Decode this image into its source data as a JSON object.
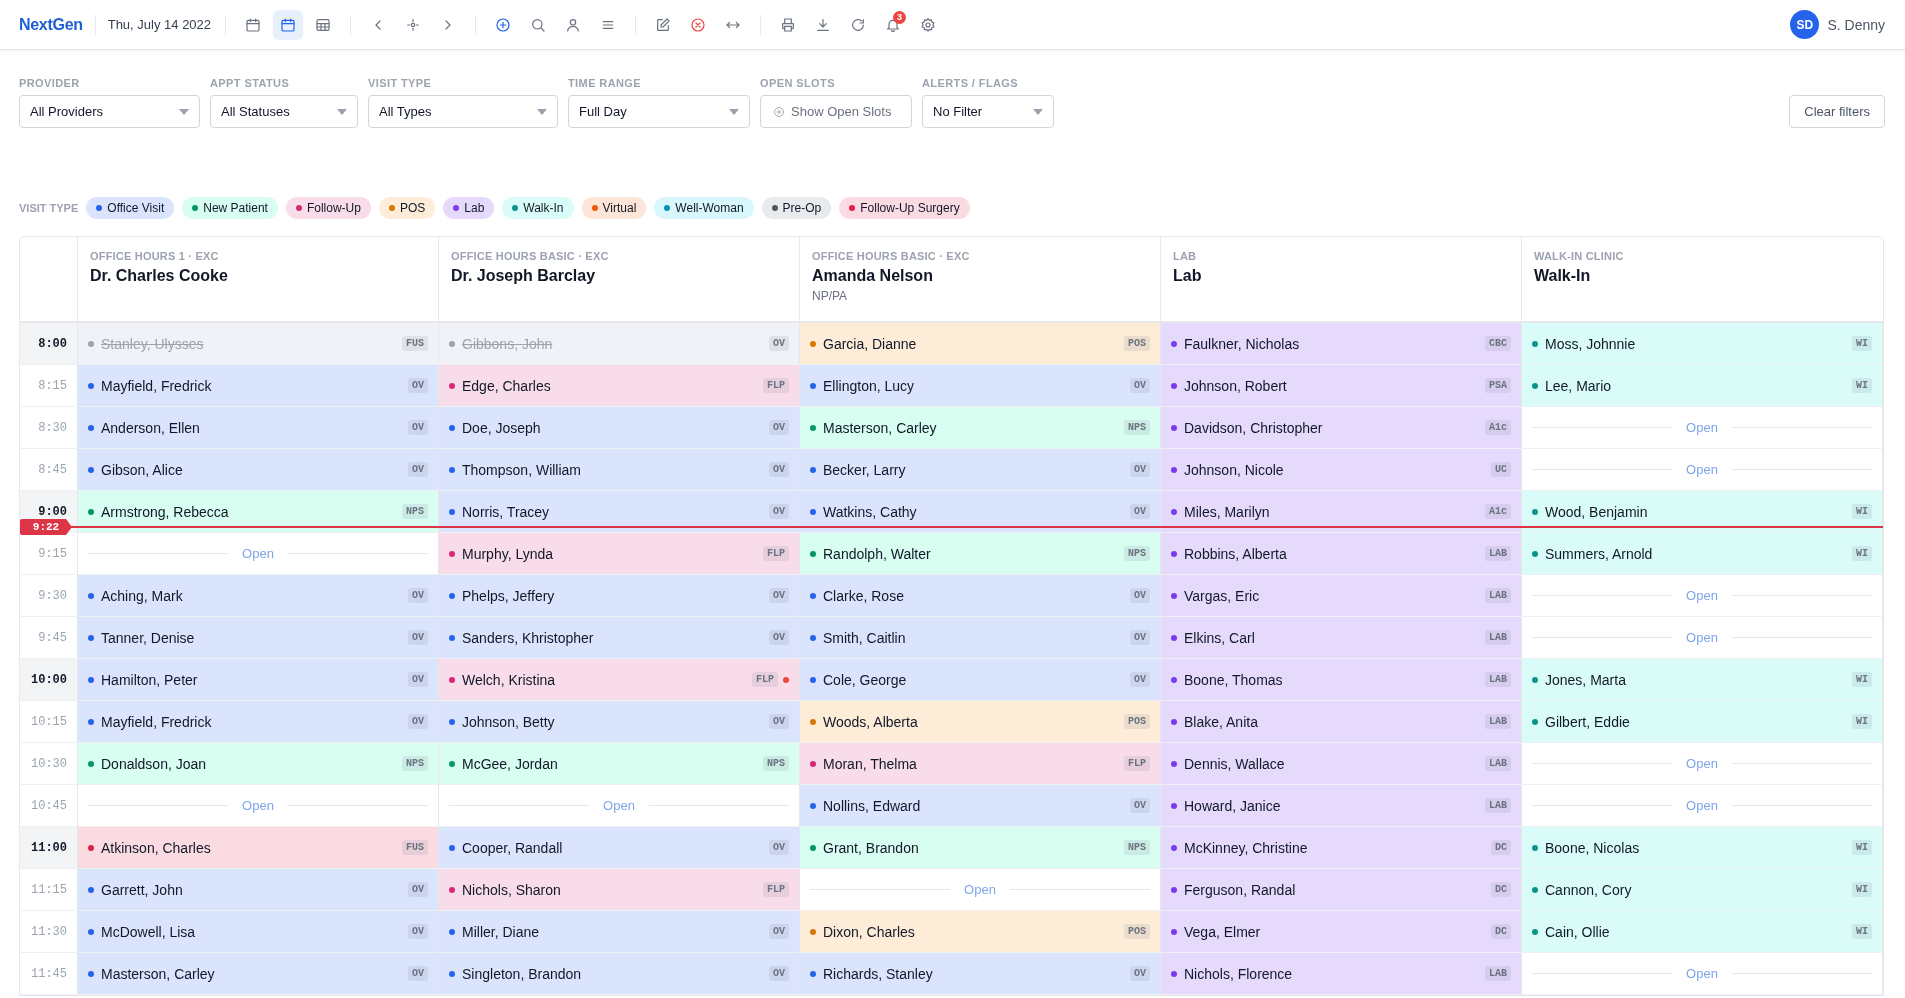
{
  "app": {
    "logo": "NextGen",
    "date": "Thu, July 14 2022"
  },
  "toolbar": [
    [
      {
        "kind": "calendar-day",
        "selected": false
      },
      {
        "kind": "calendar-week",
        "selected": true
      },
      {
        "kind": "table-grid",
        "selected": false
      }
    ],
    [
      {
        "kind": "chevron-left",
        "selected": false
      },
      {
        "kind": "crosshair",
        "selected": false
      },
      {
        "kind": "chevron-right",
        "selected": false
      }
    ],
    [
      {
        "kind": "plus-circle",
        "selected": false
      },
      {
        "kind": "search",
        "selected": false
      },
      {
        "kind": "user",
        "selected": false
      },
      {
        "kind": "list",
        "selected": false
      }
    ],
    [
      {
        "kind": "edit",
        "selected": false
      },
      {
        "kind": "x-circle",
        "selected": false
      },
      {
        "kind": "arrows-horizontal",
        "selected": false
      }
    ],
    [
      {
        "kind": "printer",
        "selected": false
      },
      {
        "kind": "download",
        "selected": false
      },
      {
        "kind": "refresh",
        "selected": false
      },
      {
        "kind": "bell",
        "selected": false,
        "badge": "3"
      },
      {
        "kind": "settings",
        "selected": false
      }
    ]
  ],
  "user": {
    "initials": "SD",
    "name": "S. Denny"
  },
  "filters": [
    {
      "label": "PROVIDER",
      "value": "All Providers",
      "kind": "select"
    },
    {
      "label": "APPT STATUS",
      "value": "All Statuses",
      "kind": "select"
    },
    {
      "label": "VISIT TYPE",
      "value": "All Types",
      "kind": "select"
    },
    {
      "label": "TIME RANGE",
      "value": "Full Day",
      "kind": "select"
    },
    {
      "label": "OPEN SLOTS",
      "value": "Show Open Slots",
      "kind": "toggle"
    },
    {
      "label": "ALERTS / FLAGS",
      "value": "No Filter",
      "kind": "select"
    }
  ],
  "clear_filters": "Clear filters",
  "legend": {
    "label": "VISIT TYPE",
    "items": [
      {
        "label": "Office Visit",
        "color": "#2563eb"
      },
      {
        "label": "New Patient",
        "color": "#059669"
      },
      {
        "label": "Follow-Up",
        "color": "#db2777"
      },
      {
        "label": "POS",
        "color": "#d97706"
      },
      {
        "label": "Lab",
        "color": "#7c3aed"
      },
      {
        "label": "Walk-In",
        "color": "#0d9488"
      },
      {
        "label": "Virtual",
        "color": "#ea580c"
      },
      {
        "label": "Well-Woman",
        "color": "#0891b2"
      },
      {
        "label": "Pre-Op",
        "color": "#4b5563"
      },
      {
        "label": "Follow-Up Surgery",
        "color": "#e11d48"
      }
    ]
  },
  "schedule": {
    "columns": [
      {
        "group": "OFFICE HOURS 1 · EXC",
        "name": "Dr. Charles Cooke"
      },
      {
        "group": "OFFICE HOURS BASIC · EXC",
        "name": "Dr. Joseph Barclay"
      },
      {
        "group": "OFFICE HOURS BASIC · EXC",
        "name": "Amanda Nelson",
        "credentials": "NP/PA"
      },
      {
        "group": "LAB",
        "name": "Lab"
      },
      {
        "group": "WALK-IN CLINIC",
        "name": "Walk-In"
      }
    ],
    "now_marker": "9:22",
    "rows": [
      {
        "time": "8:00",
        "hour": true,
        "slots": [
          {
            "kind": "cancelled",
            "patient": "Stanley, Ulysses",
            "code": "FUS"
          },
          {
            "kind": "cancelled",
            "patient": "Gibbons, John",
            "code": "OV"
          },
          {
            "kind": "booked",
            "patient": "Garcia, Dianne",
            "code": "POS",
            "color": "#d97706",
            "flag": false
          },
          {
            "kind": "booked",
            "patient": "Faulkner, Nicholas",
            "code": "CBC",
            "color": "#7c3aed",
            "flag": false
          },
          {
            "kind": "booked",
            "patient": "Moss, Johnnie",
            "code": "WI",
            "color": "#0d9488",
            "flag": false
          }
        ]
      },
      {
        "time": "8:15",
        "hour": false,
        "slots": [
          {
            "kind": "booked",
            "patient": "Mayfield, Fredrick",
            "code": "OV",
            "color": "#2563eb",
            "flag": false
          },
          {
            "kind": "booked",
            "patient": "Edge, Charles",
            "code": "FLP",
            "color": "#db2777",
            "flag": false
          },
          {
            "kind": "booked",
            "patient": "Ellington, Lucy",
            "code": "OV",
            "color": "#2563eb",
            "flag": false
          },
          {
            "kind": "booked",
            "patient": "Johnson, Robert",
            "code": "PSA",
            "color": "#7c3aed",
            "flag": false
          },
          {
            "kind": "booked",
            "patient": "Lee, Mario",
            "code": "WI",
            "color": "#0d9488",
            "flag": false
          }
        ]
      },
      {
        "time": "8:30",
        "hour": false,
        "slots": [
          {
            "kind": "booked",
            "patient": "Anderson, Ellen",
            "code": "OV",
            "color": "#2563eb",
            "flag": false
          },
          {
            "kind": "booked",
            "patient": "Doe, Joseph",
            "code": "OV",
            "color": "#2563eb",
            "flag": false
          },
          {
            "kind": "booked",
            "patient": "Masterson, Carley",
            "code": "NPS",
            "color": "#059669",
            "flag": false
          },
          {
            "kind": "booked",
            "patient": "Davidson, Christopher",
            "code": "A1c",
            "color": "#7c3aed",
            "flag": false
          },
          {
            "kind": "open",
            "label": "Open"
          }
        ]
      },
      {
        "time": "8:45",
        "hour": false,
        "slots": [
          {
            "kind": "booked",
            "patient": "Gibson, Alice",
            "code": "OV",
            "color": "#2563eb",
            "flag": false
          },
          {
            "kind": "booked",
            "patient": "Thompson, William",
            "code": "OV",
            "color": "#2563eb",
            "flag": false
          },
          {
            "kind": "booked",
            "patient": "Becker, Larry",
            "code": "OV",
            "color": "#2563eb",
            "flag": false
          },
          {
            "kind": "booked",
            "patient": "Johnson, Nicole",
            "code": "UC",
            "color": "#7c3aed",
            "flag": false
          },
          {
            "kind": "open",
            "label": "Open"
          }
        ]
      },
      {
        "time": "9:00",
        "hour": true,
        "slots": [
          {
            "kind": "booked",
            "patient": "Armstrong, Rebecca",
            "code": "NPS",
            "color": "#059669",
            "flag": false
          },
          {
            "kind": "booked",
            "patient": "Norris, Tracey",
            "code": "OV",
            "color": "#2563eb",
            "flag": false
          },
          {
            "kind": "booked",
            "patient": "Watkins, Cathy",
            "code": "OV",
            "color": "#2563eb",
            "flag": false
          },
          {
            "kind": "booked",
            "patient": "Miles, Marilyn",
            "code": "A1c",
            "color": "#7c3aed",
            "flag": false
          },
          {
            "kind": "booked",
            "patient": "Wood, Benjamin",
            "code": "WI",
            "color": "#0d9488",
            "flag": false
          }
        ]
      },
      {
        "time": "9:15",
        "hour": false,
        "slots": [
          {
            "kind": "open",
            "label": "Open"
          },
          {
            "kind": "booked",
            "patient": "Murphy, Lynda",
            "code": "FLP",
            "color": "#db2777",
            "flag": false
          },
          {
            "kind": "booked",
            "patient": "Randolph, Walter",
            "code": "NPS",
            "color": "#059669",
            "flag": false
          },
          {
            "kind": "booked",
            "patient": "Robbins, Alberta",
            "code": "LAB",
            "color": "#7c3aed",
            "flag": false
          },
          {
            "kind": "booked",
            "patient": "Summers, Arnold",
            "code": "WI",
            "color": "#0d9488",
            "flag": false
          }
        ]
      },
      {
        "time": "9:30",
        "hour": false,
        "slots": [
          {
            "kind": "booked",
            "patient": "Aching, Mark",
            "code": "OV",
            "color": "#2563eb",
            "flag": false
          },
          {
            "kind": "booked",
            "patient": "Phelps, Jeffery",
            "code": "OV",
            "color": "#2563eb",
            "flag": false
          },
          {
            "kind": "booked",
            "patient": "Clarke, Rose",
            "code": "OV",
            "color": "#2563eb",
            "flag": false
          },
          {
            "kind": "booked",
            "patient": "Vargas, Eric",
            "code": "LAB",
            "color": "#7c3aed",
            "flag": false
          },
          {
            "kind": "open",
            "label": "Open"
          }
        ]
      },
      {
        "time": "9:45",
        "hour": false,
        "slots": [
          {
            "kind": "booked",
            "patient": "Tanner, Denise",
            "code": "OV",
            "color": "#2563eb",
            "flag": false
          },
          {
            "kind": "booked",
            "patient": "Sanders, Khristopher",
            "code": "OV",
            "color": "#2563eb",
            "flag": false
          },
          {
            "kind": "booked",
            "patient": "Smith, Caitlin",
            "code": "OV",
            "color": "#2563eb",
            "flag": false
          },
          {
            "kind": "booked",
            "patient": "Elkins, Carl",
            "code": "LAB",
            "color": "#7c3aed",
            "flag": false
          },
          {
            "kind": "open",
            "label": "Open"
          }
        ]
      },
      {
        "time": "10:00",
        "hour": true,
        "slots": [
          {
            "kind": "booked",
            "patient": "Hamilton, Peter",
            "code": "OV",
            "color": "#2563eb",
            "flag": false
          },
          {
            "kind": "booked",
            "patient": "Welch, Kristina",
            "code": "FLP",
            "color": "#db2777",
            "flag": true
          },
          {
            "kind": "booked",
            "patient": "Cole, George",
            "code": "OV",
            "color": "#2563eb",
            "flag": false
          },
          {
            "kind": "booked",
            "patient": "Boone, Thomas",
            "code": "LAB",
            "color": "#7c3aed",
            "flag": false
          },
          {
            "kind": "booked",
            "patient": "Jones, Marta",
            "code": "WI",
            "color": "#0d9488",
            "flag": false
          }
        ]
      },
      {
        "time": "10:15",
        "hour": false,
        "slots": [
          {
            "kind": "booked",
            "patient": "Mayfield, Fredrick",
            "code": "OV",
            "color": "#2563eb",
            "flag": false
          },
          {
            "kind": "booked",
            "patient": "Johnson, Betty",
            "code": "OV",
            "color": "#2563eb",
            "flag": false
          },
          {
            "kind": "booked",
            "patient": "Woods, Alberta",
            "code": "POS",
            "color": "#d97706",
            "flag": false
          },
          {
            "kind": "booked",
            "patient": "Blake, Anita",
            "code": "LAB",
            "color": "#7c3aed",
            "flag": false
          },
          {
            "kind": "booked",
            "patient": "Gilbert, Eddie",
            "code": "WI",
            "color": "#0d9488",
            "flag": false
          }
        ]
      },
      {
        "time": "10:30",
        "hour": false,
        "slots": [
          {
            "kind": "booked",
            "patient": "Donaldson, Joan",
            "code": "NPS",
            "color": "#059669",
            "flag": false
          },
          {
            "kind": "booked",
            "patient": "McGee, Jordan",
            "code": "NPS",
            "color": "#059669",
            "flag": false
          },
          {
            "kind": "booked",
            "patient": "Moran, Thelma",
            "code": "FLP",
            "color": "#db2777",
            "flag": false
          },
          {
            "kind": "booked",
            "patient": "Dennis, Wallace",
            "code": "LAB",
            "color": "#7c3aed",
            "flag": false
          },
          {
            "kind": "open",
            "label": "Open"
          }
        ]
      },
      {
        "time": "10:45",
        "hour": false,
        "slots": [
          {
            "kind": "open",
            "label": "Open"
          },
          {
            "kind": "open",
            "label": "Open"
          },
          {
            "kind": "booked",
            "patient": "Nollins, Edward",
            "code": "OV",
            "color": "#2563eb",
            "flag": false
          },
          {
            "kind": "booked",
            "patient": "Howard, Janice",
            "code": "LAB",
            "color": "#7c3aed",
            "flag": false
          },
          {
            "kind": "open",
            "label": "Open"
          }
        ]
      },
      {
        "time": "11:00",
        "hour": true,
        "slots": [
          {
            "kind": "booked",
            "patient": "Atkinson, Charles",
            "code": "FUS",
            "color": "#e11d48",
            "flag": false
          },
          {
            "kind": "booked",
            "patient": "Cooper, Randall",
            "code": "OV",
            "color": "#2563eb",
            "flag": false
          },
          {
            "kind": "booked",
            "patient": "Grant, Brandon",
            "code": "NPS",
            "color": "#059669",
            "flag": false
          },
          {
            "kind": "booked",
            "patient": "McKinney, Christine",
            "code": "DC",
            "color": "#7c3aed",
            "flag": false
          },
          {
            "kind": "booked",
            "patient": "Boone, Nicolas",
            "code": "WI",
            "color": "#0d9488",
            "flag": false
          }
        ]
      },
      {
        "time": "11:15",
        "hour": false,
        "slots": [
          {
            "kind": "booked",
            "patient": "Garrett, John",
            "code": "OV",
            "color": "#2563eb",
            "flag": false
          },
          {
            "kind": "booked",
            "patient": "Nichols, Sharon",
            "code": "FLP",
            "color": "#db2777",
            "flag": false
          },
          {
            "kind": "open",
            "label": "Open"
          },
          {
            "kind": "booked",
            "patient": "Ferguson, Randal",
            "code": "DC",
            "color": "#7c3aed",
            "flag": false
          },
          {
            "kind": "booked",
            "patient": "Cannon, Cory",
            "code": "WI",
            "color": "#0d9488",
            "flag": false
          }
        ]
      },
      {
        "time": "11:30",
        "hour": false,
        "slots": [
          {
            "kind": "booked",
            "patient": "McDowell, Lisa",
            "code": "OV",
            "color": "#2563eb",
            "flag": false
          },
          {
            "kind": "booked",
            "patient": "Miller, Diane",
            "code": "OV",
            "color": "#2563eb",
            "flag": false
          },
          {
            "kind": "booked",
            "patient": "Dixon, Charles",
            "code": "POS",
            "color": "#d97706",
            "flag": false
          },
          {
            "kind": "booked",
            "patient": "Vega, Elmer",
            "code": "DC",
            "color": "#7c3aed",
            "flag": false
          },
          {
            "kind": "booked",
            "patient": "Cain, Ollie",
            "code": "WI",
            "color": "#0d9488",
            "flag": false
          }
        ]
      },
      {
        "time": "11:45",
        "hour": false,
        "slots": [
          {
            "kind": "booked",
            "patient": "Masterson, Carley",
            "code": "OV",
            "color": "#2563eb",
            "flag": false
          },
          {
            "kind": "booked",
            "patient": "Singleton, Brandon",
            "code": "OV",
            "color": "#2563eb",
            "flag": false
          },
          {
            "kind": "booked",
            "patient": "Richards, Stanley",
            "code": "OV",
            "color": "#2563eb",
            "flag": false
          },
          {
            "kind": "booked",
            "patient": "Nichols, Florence",
            "code": "LAB",
            "color": "#7c3aed",
            "flag": false
          },
          {
            "kind": "open",
            "label": "Open"
          }
        ]
      }
    ]
  }
}
